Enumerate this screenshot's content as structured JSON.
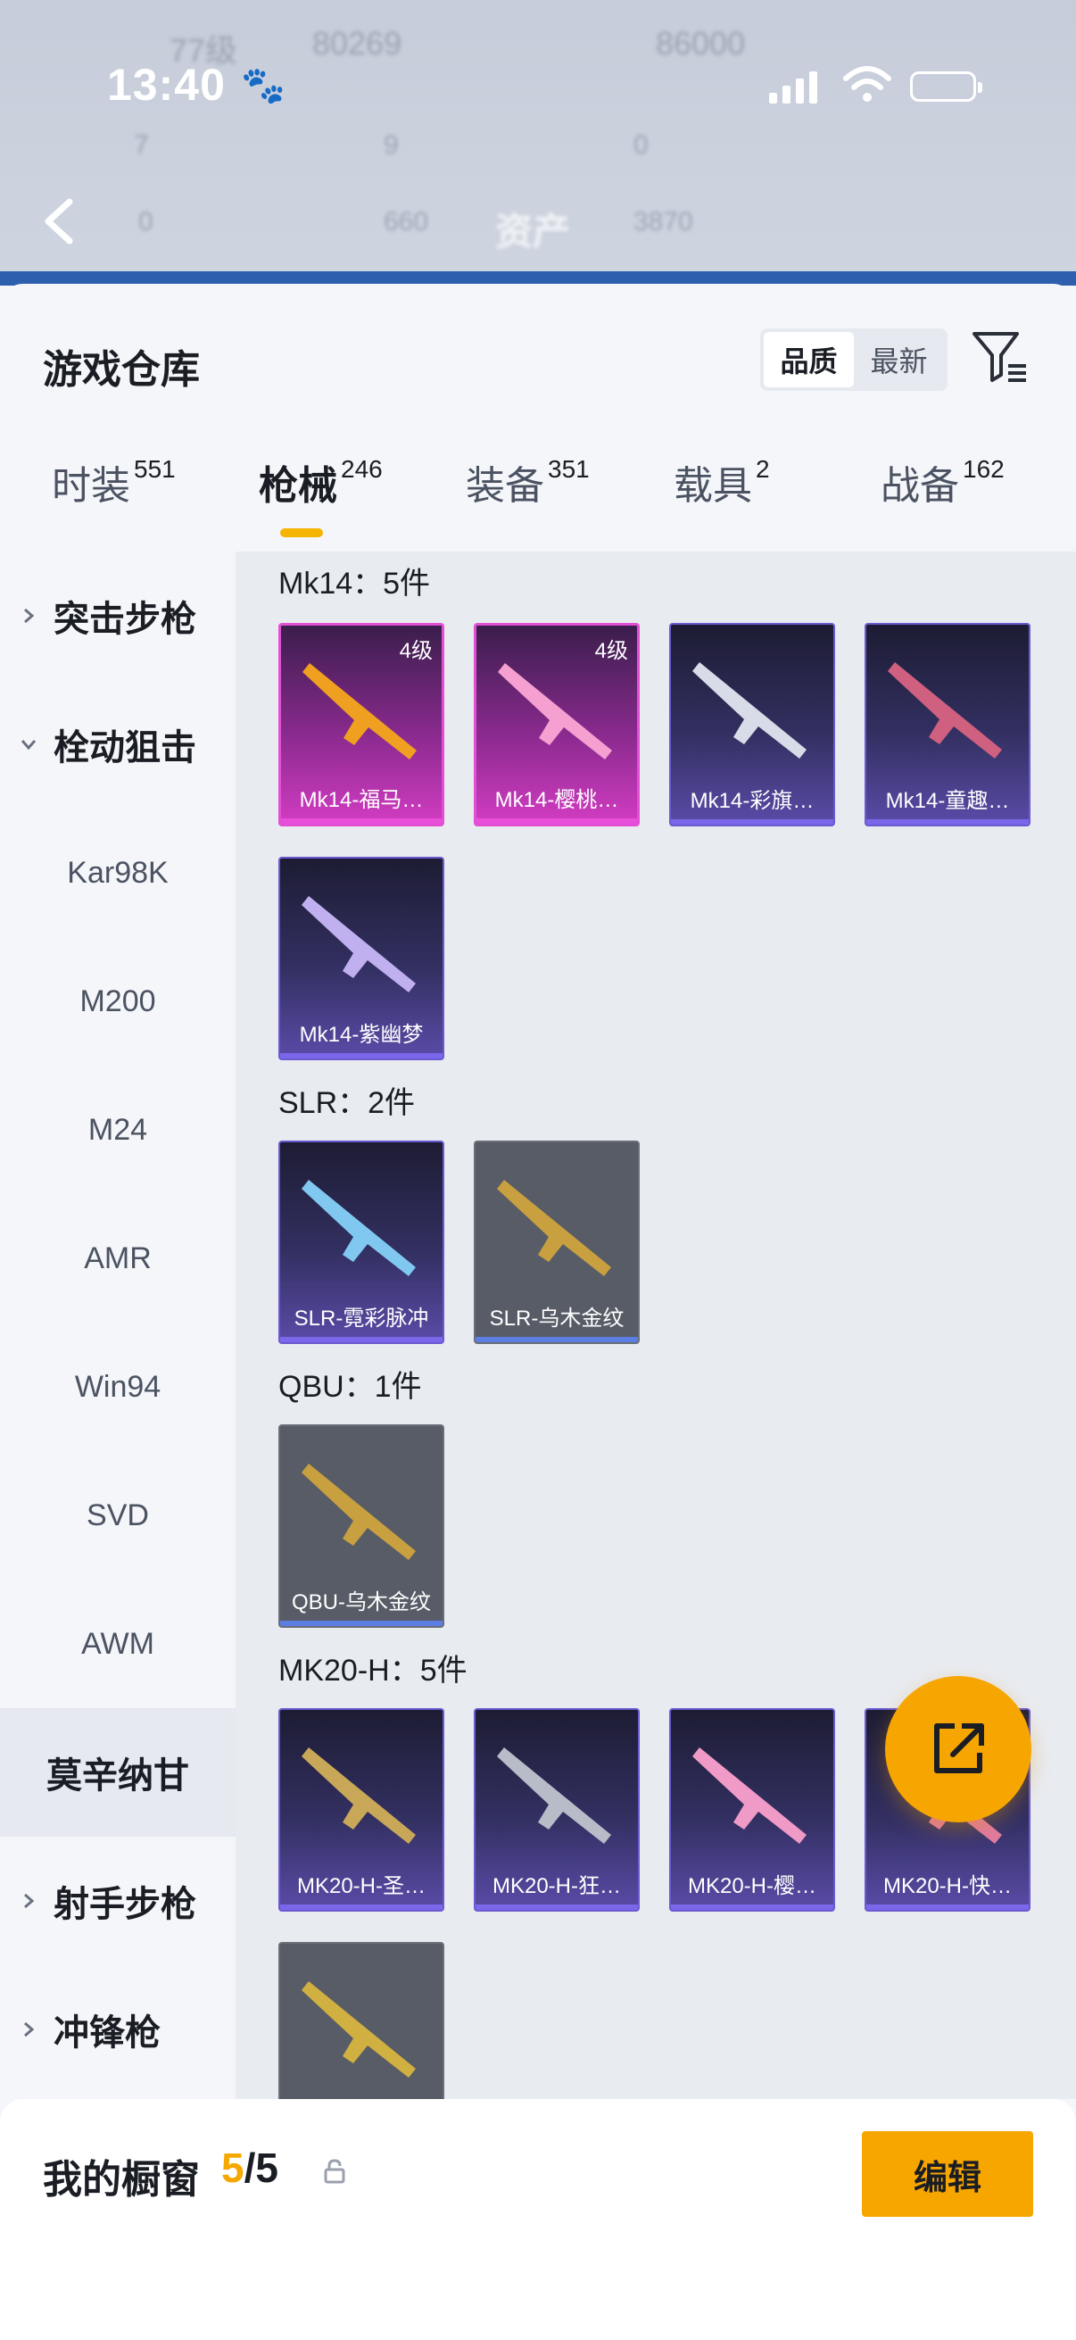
{
  "status_bar": {
    "time": "13:40",
    "paw": "🐾"
  },
  "blurred_header": {
    "row1": [
      "77级",
      "80269",
      "86000"
    ],
    "row2": [
      "7",
      "9",
      "0"
    ],
    "row3": [
      "0",
      "660",
      "资产",
      "3870"
    ]
  },
  "page": {
    "title": "游戏仓库",
    "sort": {
      "quality": "品质",
      "newest": "最新",
      "selected": "品质"
    }
  },
  "tabs": [
    {
      "label": "时装",
      "count": "551"
    },
    {
      "label": "枪械",
      "count": "246"
    },
    {
      "label": "装备",
      "count": "351"
    },
    {
      "label": "载具",
      "count": "2"
    },
    {
      "label": "战备",
      "count": "162"
    }
  ],
  "sidebar": [
    {
      "label": "突击步枪",
      "type": "group",
      "expanded": false
    },
    {
      "label": "栓动狙击",
      "type": "group",
      "expanded": true
    },
    {
      "label": "Kar98K",
      "type": "item"
    },
    {
      "label": "M200",
      "type": "item"
    },
    {
      "label": "M24",
      "type": "item"
    },
    {
      "label": "AMR",
      "type": "item"
    },
    {
      "label": "Win94",
      "type": "item"
    },
    {
      "label": "SVD",
      "type": "item"
    },
    {
      "label": "AWM",
      "type": "item"
    },
    {
      "label": "莫辛纳甘",
      "type": "item",
      "selected": true
    },
    {
      "label": "射手步枪",
      "type": "group",
      "expanded": false
    },
    {
      "label": "冲锋枪",
      "type": "group",
      "expanded": false
    }
  ],
  "sections": [
    {
      "title": "Mk14：5件",
      "cards": [
        {
          "name": "Mk14-福马…",
          "level": "4级",
          "rarity": "pink",
          "gun_color": "#f0a020"
        },
        {
          "name": "Mk14-樱桃…",
          "level": "4级",
          "rarity": "pink",
          "gun_color": "#f5a0d0"
        },
        {
          "name": "Mk14-彩旗…",
          "rarity": "purple",
          "gun_color": "#d8dce8"
        },
        {
          "name": "Mk14-童趣…",
          "rarity": "purple",
          "gun_color": "#d06080"
        },
        {
          "name": "Mk14-紫幽梦",
          "rarity": "purple",
          "gun_color": "#c0b0f0"
        }
      ]
    },
    {
      "title": "SLR：2件",
      "cards": [
        {
          "name": "SLR-霓彩脉冲",
          "rarity": "purple",
          "gun_color": "#80c8f0"
        },
        {
          "name": "SLR-乌木金纹",
          "rarity": "gray",
          "gun_color": "#c8a040"
        }
      ]
    },
    {
      "title": "QBU：1件",
      "cards": [
        {
          "name": "QBU-乌木金纹",
          "rarity": "gray",
          "gun_color": "#c8a040"
        }
      ]
    },
    {
      "title": "MK20-H：5件",
      "cards": [
        {
          "name": "MK20-H-圣…",
          "rarity": "purple",
          "gun_color": "#c8a858"
        },
        {
          "name": "MK20-H-狂…",
          "rarity": "purple",
          "gun_color": "#b8bcc8"
        },
        {
          "name": "MK20-H-樱…",
          "rarity": "purple",
          "gun_color": "#f09ac8"
        },
        {
          "name": "MK20-H-快…",
          "rarity": "purple",
          "gun_color": "#e07aa0"
        },
        {
          "name": "",
          "rarity": "gray",
          "gun_color": "#d0b040"
        }
      ]
    }
  ],
  "showcase": {
    "label": "我的橱窗",
    "count": "5",
    "separator": "/",
    "max": "5",
    "edit_button": "编辑"
  },
  "colors": {
    "accent": "#f7a600",
    "pink_rarity": "#e24fd5",
    "purple_rarity": "#6a5ad0"
  }
}
